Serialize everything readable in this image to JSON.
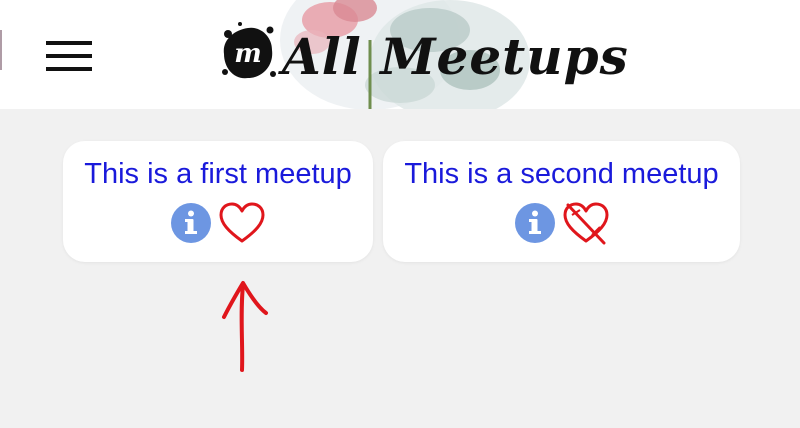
{
  "header": {
    "title": "All Meetups",
    "logo_letter": "m",
    "menu_icon": "hamburger-menu-icon"
  },
  "meetups": [
    {
      "title": "This is a first meetup",
      "info_icon": "info-icon",
      "favorite_icon": "heart-outline-icon"
    },
    {
      "title": "This is a second meetup",
      "info_icon": "info-icon",
      "favorite_icon": "heart-crossed-icon"
    }
  ],
  "colors": {
    "title_text": "#1a1adb",
    "info_icon": "#6d96e2",
    "heart": "#e0161c",
    "annotation_arrow": "#e0161c",
    "page_background": "#f1f1f1"
  }
}
